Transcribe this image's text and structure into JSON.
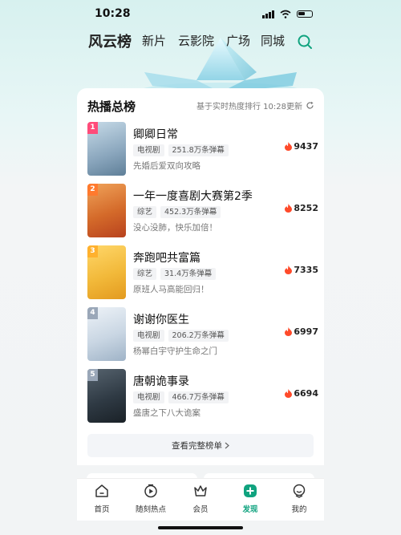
{
  "status_bar": {
    "time": "10:28"
  },
  "nav": {
    "tabs": [
      {
        "label": "风云榜",
        "active": true
      },
      {
        "label": "新片"
      },
      {
        "label": "云影院"
      },
      {
        "label": "广场"
      },
      {
        "label": "同城"
      }
    ],
    "search_icon": "search-icon"
  },
  "section": {
    "title": "热播总榜",
    "update_note": "基于实时热度排行 10:28更新",
    "refresh_icon": "refresh-icon"
  },
  "rankings": [
    {
      "rank": "1",
      "title": "卿卿日常",
      "type": "电视剧",
      "danmaku": "251.8万条弹幕",
      "desc": "先婚后爱双向攻略",
      "heat": "9437",
      "rank_color": "#ff4c7a",
      "poster_color": "#8aa6bd"
    },
    {
      "rank": "2",
      "title": "一年一度喜剧大赛第2季",
      "type": "综艺",
      "danmaku": "452.3万条弹幕",
      "desc": "没心没肺，快乐加倍！",
      "heat": "8252",
      "rank_color": "#ff7a2e",
      "poster_color": "#d46a2a"
    },
    {
      "rank": "3",
      "title": "奔跑吧共富篇",
      "type": "综艺",
      "danmaku": "31.4万条弹幕",
      "desc": "原班人马高能回归！",
      "heat": "7335",
      "rank_color": "#ffb12e",
      "poster_color": "#f2b93a"
    },
    {
      "rank": "4",
      "title": "谢谢你医生",
      "type": "电视剧",
      "danmaku": "206.2万条弹幕",
      "desc": "杨幂白宇守护生命之门",
      "heat": "6997",
      "rank_color": "#9aa7b8",
      "poster_color": "#c9d6e3"
    },
    {
      "rank": "5",
      "title": "唐朝诡事录",
      "type": "电视剧",
      "danmaku": "466.7万条弹幕",
      "desc": "盛唐之下八大诡案",
      "heat": "6694",
      "rank_color": "#9aa7b8",
      "poster_color": "#2f3a44"
    }
  ],
  "view_full": "查看完整榜单",
  "tabbar": {
    "items": [
      {
        "label": "首页",
        "icon": "home-icon"
      },
      {
        "label": "随刻热点",
        "icon": "play-icon"
      },
      {
        "label": "会员",
        "icon": "crown-icon"
      },
      {
        "label": "发现",
        "icon": "discover-icon",
        "active": true
      },
      {
        "label": "我的",
        "icon": "profile-icon"
      }
    ]
  },
  "accent": "#10a37f",
  "heat_color": "#ff4a2a"
}
